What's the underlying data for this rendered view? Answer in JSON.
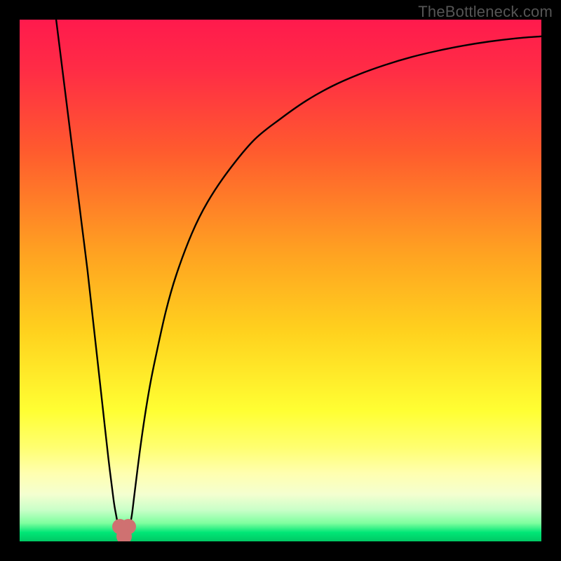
{
  "watermark": "TheBottleneck.com",
  "gradient_stops": [
    {
      "pct": 0,
      "color": "#ff1a4d"
    },
    {
      "pct": 10,
      "color": "#ff2d45"
    },
    {
      "pct": 25,
      "color": "#ff5a2e"
    },
    {
      "pct": 45,
      "color": "#ffa321"
    },
    {
      "pct": 60,
      "color": "#ffd21e"
    },
    {
      "pct": 75,
      "color": "#ffff33"
    },
    {
      "pct": 82,
      "color": "#ffff70"
    },
    {
      "pct": 87,
      "color": "#ffffb0"
    },
    {
      "pct": 91,
      "color": "#f4ffd0"
    },
    {
      "pct": 94,
      "color": "#c8ffc8"
    },
    {
      "pct": 96.5,
      "color": "#7fff9f"
    },
    {
      "pct": 98.3,
      "color": "#00e676"
    },
    {
      "pct": 100,
      "color": "#00c864"
    }
  ],
  "chart_data": {
    "type": "line",
    "title": "",
    "xlabel": "",
    "ylabel": "",
    "xlim": [
      0,
      100
    ],
    "ylim": [
      0,
      100
    ],
    "series": [
      {
        "name": "bottleneck-curve",
        "x": [
          7,
          8,
          9,
          10,
          11,
          12,
          13,
          14,
          15,
          16,
          17,
          18,
          18.5,
          19,
          19.5,
          20,
          20.5,
          21,
          21.5,
          22,
          23,
          24,
          25,
          26,
          28,
          30,
          33,
          36,
          40,
          45,
          50,
          55,
          60,
          65,
          70,
          75,
          80,
          85,
          90,
          95,
          100
        ],
        "y": [
          100,
          92,
          84,
          76,
          68,
          60,
          52,
          43,
          34,
          25,
          16,
          8,
          5,
          2.5,
          1.2,
          0.7,
          1.2,
          2.5,
          5,
          9,
          17,
          24,
          30,
          35,
          44,
          51,
          59,
          65,
          71,
          77,
          81,
          84.5,
          87.3,
          89.5,
          91.3,
          92.8,
          94,
          95,
          95.8,
          96.4,
          96.8
        ]
      }
    ],
    "highlight_dots": [
      {
        "x": 19.2,
        "y": 2.8
      },
      {
        "x": 20.8,
        "y": 2.8
      },
      {
        "x": 20.0,
        "y": 0.9
      }
    ],
    "grid": false,
    "legend": false
  }
}
